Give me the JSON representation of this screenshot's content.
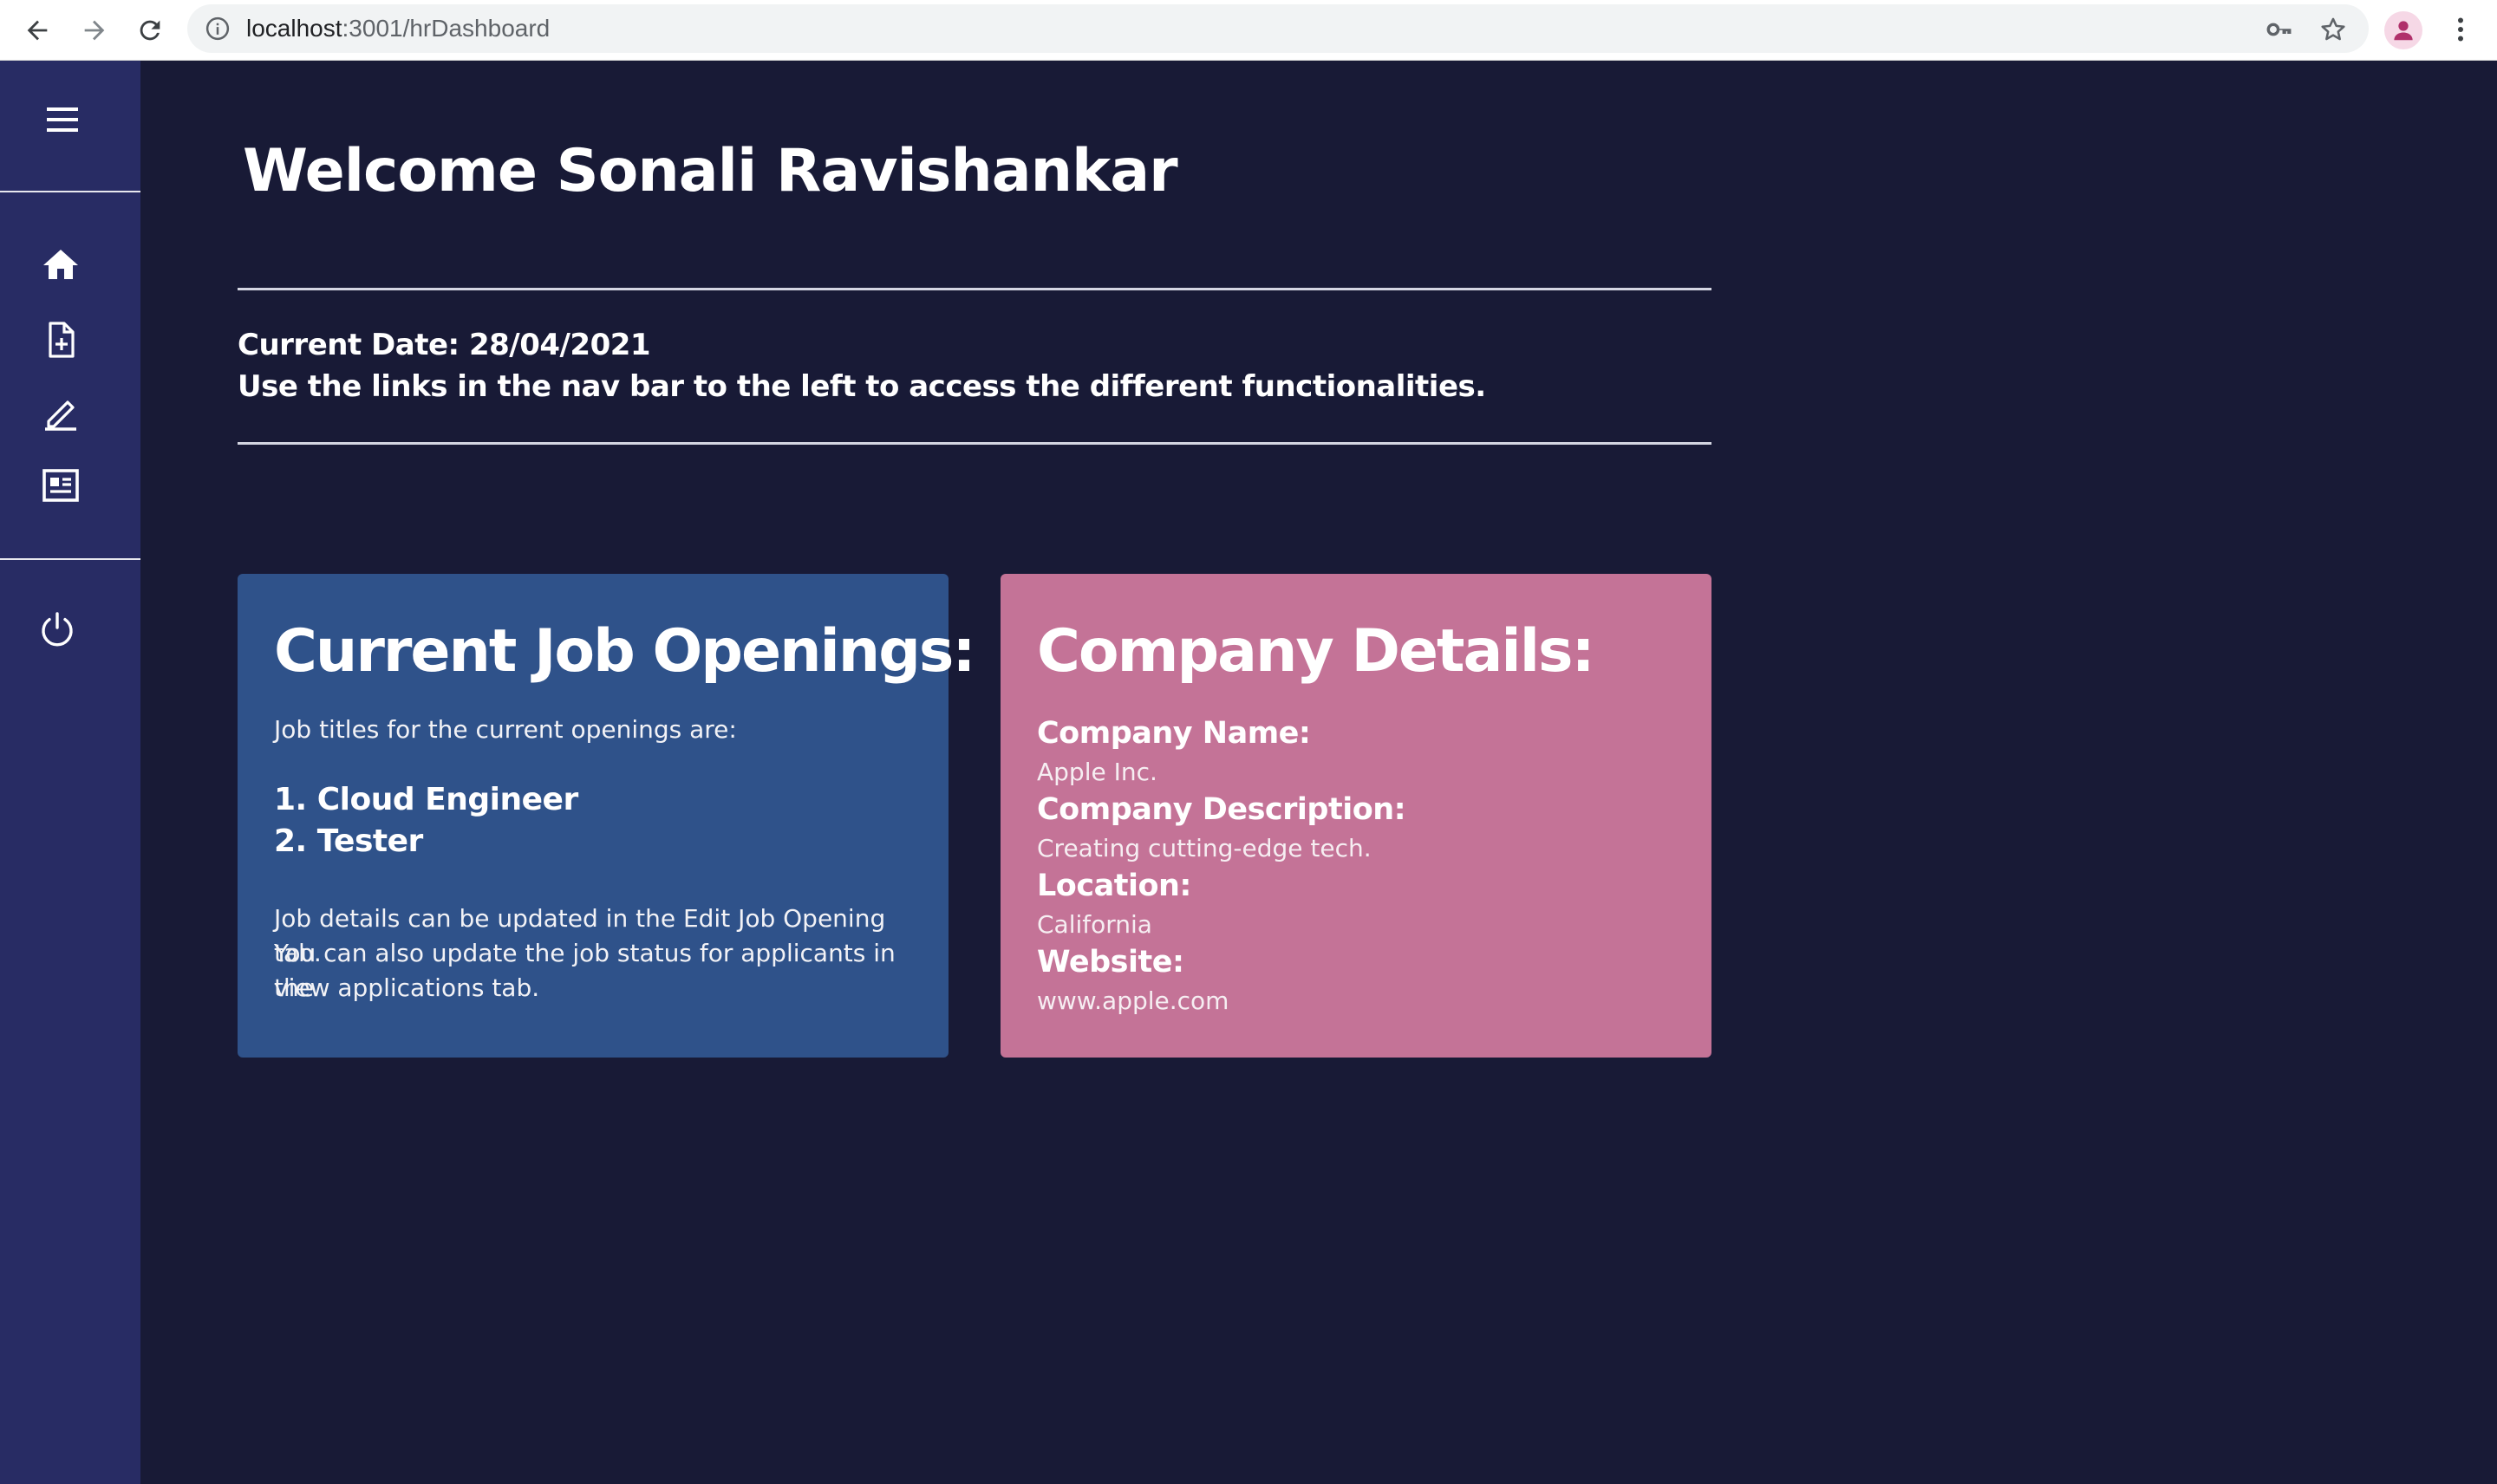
{
  "browser": {
    "url_host": "localhost",
    "url_path": ":3001/hrDashboard"
  },
  "sidebar": {
    "items": [
      {
        "icon": "menu-icon"
      },
      {
        "icon": "home-icon"
      },
      {
        "icon": "add-document-icon"
      },
      {
        "icon": "edit-icon"
      },
      {
        "icon": "applications-icon"
      },
      {
        "icon": "power-icon"
      }
    ]
  },
  "main": {
    "welcome": "Welcome Sonali Ravishankar",
    "current_date": "Current Date: 28/04/2021",
    "instructions": "Use the links in the nav bar to the left to access the different functionalities."
  },
  "jobs_card": {
    "title": "Current Job Openings:",
    "intro": "Job titles for the current openings are:",
    "items": [
      "1. Cloud Engineer",
      "2. Tester"
    ],
    "note_line1": "Job details can be updated in the Edit Job Opening tab.",
    "note_line2": "You can also update the job status for applicants in the",
    "note_line3": "view applications tab."
  },
  "company_card": {
    "title": "Company Details:",
    "fields": [
      {
        "label": "Company Name:",
        "value": "Apple Inc."
      },
      {
        "label": "Company Description:",
        "value": "Creating cutting-edge tech."
      },
      {
        "label": "Location:",
        "value": "California"
      },
      {
        "label": "Website:",
        "value": "www.apple.com"
      }
    ]
  },
  "colors": {
    "background": "#181a36",
    "sidebar": "#282c64",
    "jobs_card": "#2f528a",
    "company_card": "#c47397"
  }
}
